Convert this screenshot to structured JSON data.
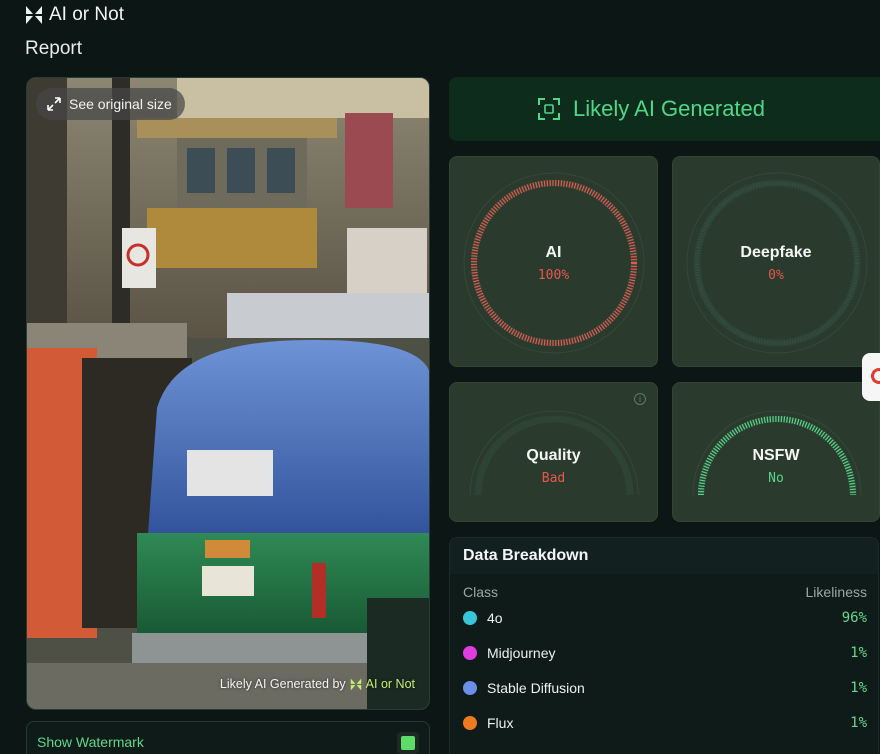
{
  "brand": {
    "name": "AI or Not",
    "icon": "logo-icon"
  },
  "page": {
    "title": "Report"
  },
  "image": {
    "see_original_label": "See original size",
    "watermark_prefix": "Likely AI Generated by",
    "watermark_brand": "AI or Not"
  },
  "show_watermark": {
    "label": "Show Watermark",
    "checked": true
  },
  "verdict": {
    "text": "Likely AI Generated",
    "color": "#4fd787"
  },
  "cards": {
    "ai": {
      "label": "AI",
      "value": "100%",
      "fraction": 1.0,
      "color": "#e8574f"
    },
    "deepfake": {
      "label": "Deepfake",
      "value": "0%",
      "fraction": 0.0,
      "color": "#e8574f"
    },
    "quality": {
      "label": "Quality",
      "value": "Bad",
      "color": "#e8574f"
    },
    "nsfw": {
      "label": "NSFW",
      "value": "No",
      "color": "#55d688"
    }
  },
  "breakdown": {
    "title": "Data Breakdown",
    "col_class": "Class",
    "col_likeliness": "Likeliness",
    "rows": [
      {
        "name": "4o",
        "value": "96%",
        "color": "#37c5d9"
      },
      {
        "name": "Midjourney",
        "value": "1%",
        "color": "#e03de0"
      },
      {
        "name": "Stable Diffusion",
        "value": "1%",
        "color": "#6a8fe8"
      },
      {
        "name": "Flux",
        "value": "1%",
        "color": "#f07a22"
      }
    ]
  }
}
